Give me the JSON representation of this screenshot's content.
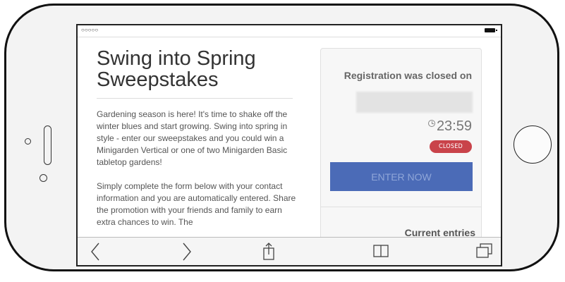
{
  "status_bar": {
    "signal": "○○○○○",
    "battery": "battery-icon"
  },
  "page": {
    "title": "Swing into Spring Sweepstakes",
    "description": "Gardening season is here! It's time to shake off the winter blues and start growing. Swing into spring in style - enter our sweepstakes and you could win a Minigarden Vertical or one of two Minigarden Basic tabletop gardens!\n\nSimply complete the form below with your contact information and you are automatically entered. Share the promotion with your friends and family to earn extra chances to win. The"
  },
  "panel": {
    "closed_heading": "Registration was closed on",
    "time": "23:59",
    "badge": "CLOSED",
    "enter_button": "ENTER NOW",
    "entries_label": "Current entries"
  },
  "toolbar": {
    "items": [
      "back-icon",
      "forward-icon",
      "share-icon",
      "bookmarks-icon",
      "tabs-icon"
    ]
  },
  "colors": {
    "badge": "#c9434a",
    "enter_button": "#4b6bb7",
    "enter_button_text": "#8fa6d8"
  }
}
